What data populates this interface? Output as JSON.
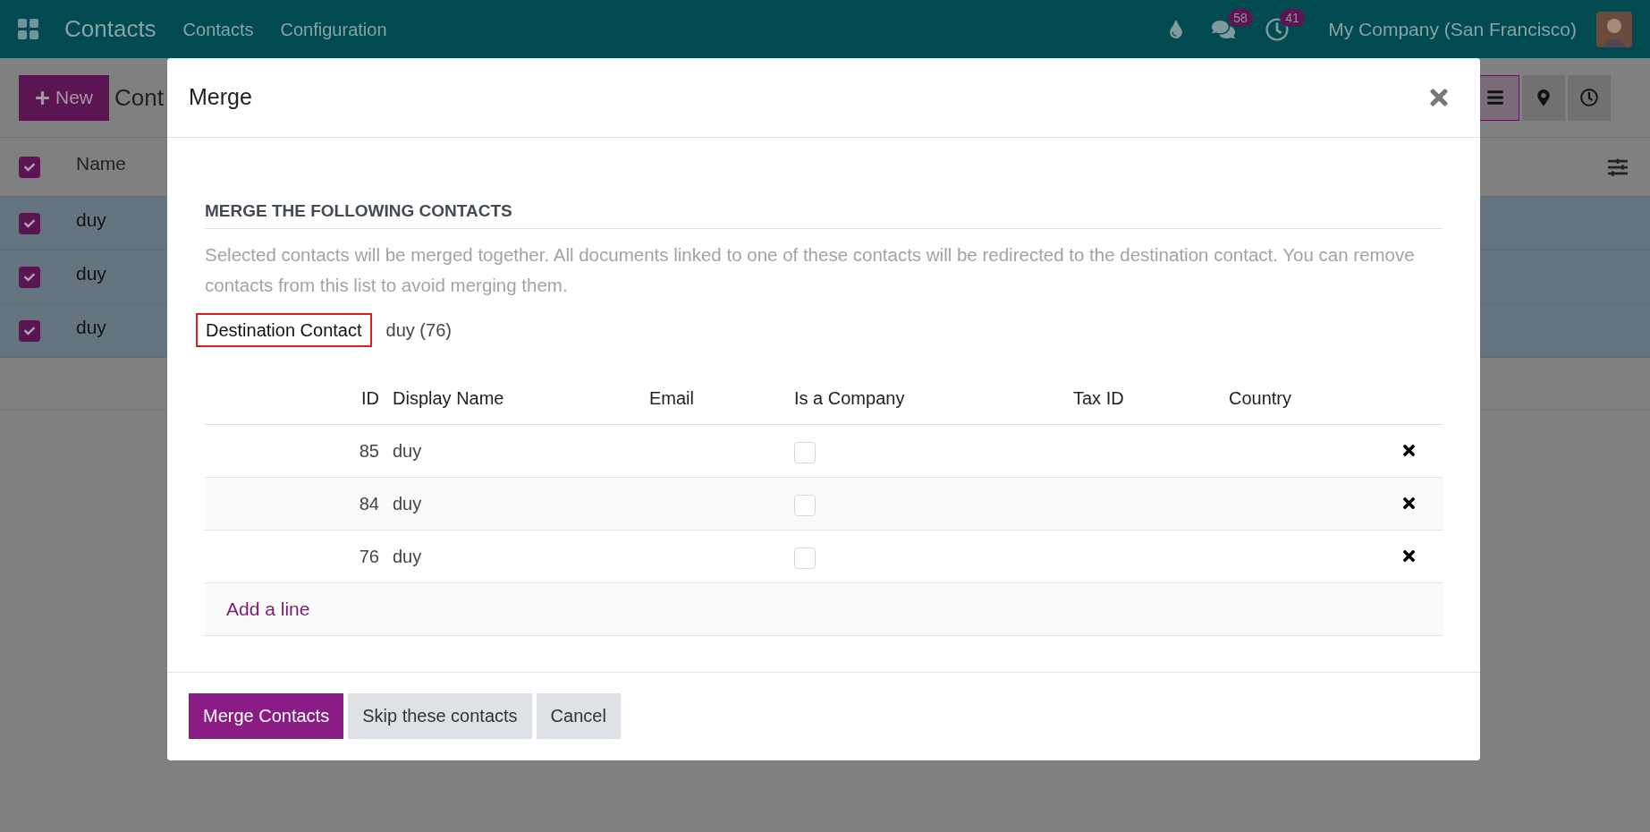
{
  "navbar": {
    "app_title": "Contacts",
    "menu": [
      "Contacts",
      "Configuration"
    ],
    "chat_badge": "58",
    "activity_badge": "41",
    "company": "My Company (San Francisco)"
  },
  "control_panel": {
    "new_button": "New",
    "breadcrumb": "Cont",
    "views": [
      {
        "kind": "list",
        "selected": true
      },
      {
        "kind": "map",
        "selected": false
      },
      {
        "kind": "activity",
        "selected": false
      }
    ]
  },
  "list": {
    "all_checked": true,
    "columns": [
      "Name"
    ],
    "rows": [
      {
        "name": "duy",
        "checked": true,
        "selected": true
      },
      {
        "name": "duy",
        "checked": true,
        "selected": true
      },
      {
        "name": "duy",
        "checked": true,
        "selected": true
      }
    ]
  },
  "dialog": {
    "title": "Merge",
    "section_title": "MERGE THE FOLLOWING CONTACTS",
    "description": "Selected contacts will be merged together. All documents linked to one of these contacts will be redirected to the destination contact. You can remove contacts from this list to avoid merging them.",
    "destination": {
      "label": "Destination Contact",
      "value": "duy (76)",
      "highlighted": true
    },
    "table": {
      "columns": [
        "ID",
        "Display Name",
        "Email",
        "Is a Company",
        "Tax ID",
        "Country"
      ],
      "rows": [
        {
          "id": "85",
          "display_name": "duy",
          "is_company": false
        },
        {
          "id": "84",
          "display_name": "duy",
          "is_company": false
        },
        {
          "id": "76",
          "display_name": "duy",
          "is_company": false
        }
      ],
      "add_line": "Add a line"
    },
    "buttons": [
      {
        "label": "Merge Contacts",
        "kind": "primary"
      },
      {
        "label": "Skip these contacts",
        "kind": "secondary"
      },
      {
        "label": "Cancel",
        "kind": "secondary"
      }
    ]
  }
}
